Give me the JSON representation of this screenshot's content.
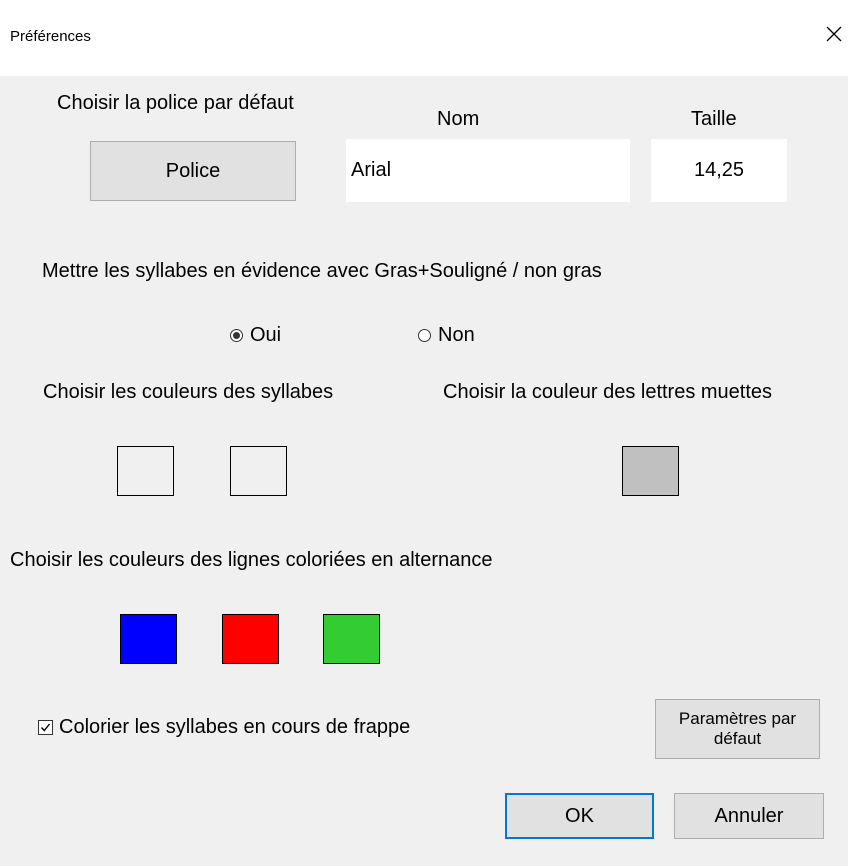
{
  "window": {
    "title": "Préférences",
    "close_icon": "close-icon"
  },
  "font": {
    "section_label": "Choisir la police par défaut",
    "button_label": "Police",
    "name_header": "Nom",
    "size_header": "Taille",
    "name_value": "Arial",
    "size_value": "14,25"
  },
  "highlight": {
    "label": "Mettre les syllabes en évidence avec Gras+Souligné / non gras",
    "options": [
      {
        "label": "Oui",
        "checked": true
      },
      {
        "label": "Non",
        "checked": false
      }
    ]
  },
  "syllable_colors": {
    "label": "Choisir les couleurs des syllabes",
    "colors": [
      "#f0f0f0",
      "#f0f0f0"
    ]
  },
  "silent_letters": {
    "label": "Choisir la couleur des lettres muettes",
    "color": "#c0c0c0"
  },
  "line_colors": {
    "label": "Choisir les couleurs des lignes coloriées en alternance",
    "colors": [
      "#0000ff",
      "#ff0000",
      "#33cc33"
    ]
  },
  "typing": {
    "label": "Colorier les syllabes en cours de frappe",
    "checked": true
  },
  "buttons": {
    "defaults_label": "Paramètres par défaut",
    "ok_label": "OK",
    "cancel_label": "Annuler"
  }
}
